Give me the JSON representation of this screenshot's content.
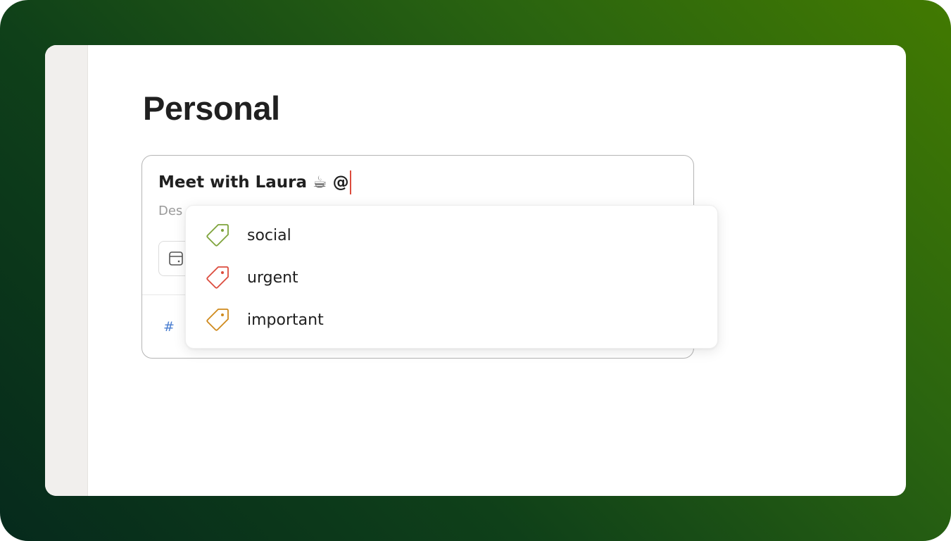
{
  "page": {
    "title": "Personal"
  },
  "task_editor": {
    "task_name": "Meet with Laura ☕ @",
    "description_placeholder": "Des",
    "project_hash": "#"
  },
  "label_dropdown": {
    "items": [
      {
        "label": "social",
        "icon": "tag-icon",
        "color": "#7ea33b"
      },
      {
        "label": "urgent",
        "icon": "tag-icon",
        "color": "#dc4c3e"
      },
      {
        "label": "important",
        "icon": "tag-icon",
        "color": "#cf8a1d"
      }
    ]
  },
  "colors": {
    "cursor": "#dc4c3e",
    "project_hash": "#4a7ed0",
    "background_gradient_start": "#062a1c",
    "background_gradient_end": "#427a01"
  }
}
